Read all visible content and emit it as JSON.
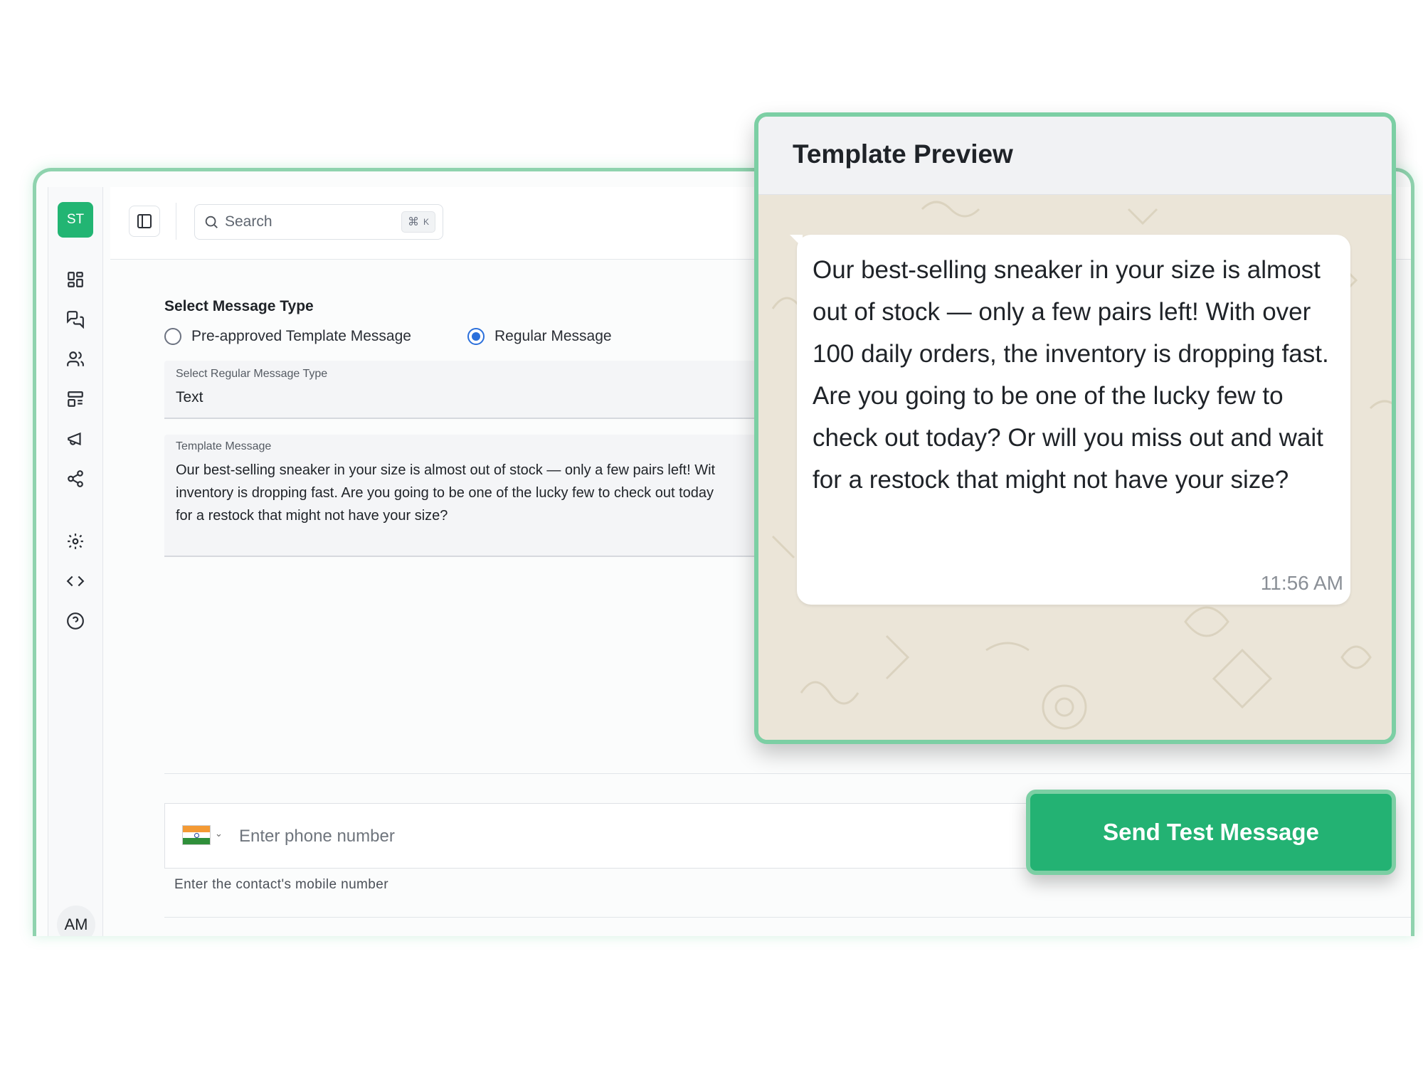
{
  "sidebar": {
    "logo_text": "ST",
    "user_initials": "AM",
    "icons": [
      "dashboard-icon",
      "chat-icon",
      "contacts-icon",
      "templates-icon",
      "campaigns-icon",
      "flows-icon",
      "settings-icon",
      "developer-icon",
      "help-icon"
    ]
  },
  "topbar": {
    "search_placeholder": "Search",
    "shortcut_symbol": "⌘",
    "shortcut_key": "K"
  },
  "form": {
    "section_title": "Select Message Type",
    "radio_options": [
      {
        "label": "Pre-approved Template Message",
        "checked": false
      },
      {
        "label": "Regular Message",
        "checked": true
      }
    ],
    "message_type": {
      "label": "Select Regular Message Type",
      "value": "Text"
    },
    "template_message": {
      "label": "Template Message",
      "lines": [
        "Our best-selling sneaker in your size is almost out of stock — only a few pairs left! Wit",
        "inventory is dropping fast. Are you going to be one of the lucky few to check out today",
        "for a restock that might not have your size?"
      ]
    },
    "phone": {
      "country": "India",
      "placeholder": "Enter phone number",
      "helper_text": "Enter the contact's mobile number"
    }
  },
  "preview": {
    "title": "Template Preview",
    "message": "Our best-selling sneaker in your size is almost out of stock — only a few pairs left! With over 100 daily orders, the inventory is dropping fast. Are you going to be one of the lucky few to check out today? Or will you miss out and wait for a restock that might not have your size?",
    "time": "11:56 AM"
  },
  "actions": {
    "send_label": "Send Test Message"
  },
  "colors": {
    "brand_green": "#22b573",
    "accent_border": "#7ccfa4",
    "radio_blue": "#2a6fdb",
    "chat_background": "#ebe5d8"
  }
}
